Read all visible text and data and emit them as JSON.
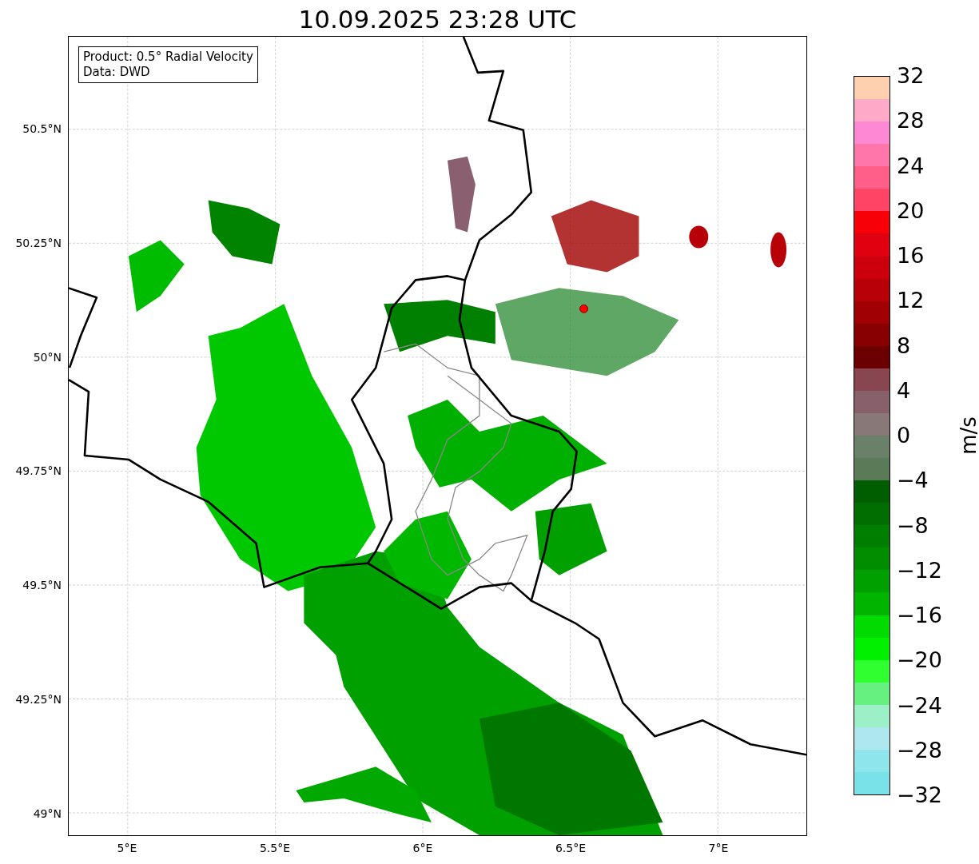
{
  "title": "10.09.2025 23:28 UTC",
  "legend": {
    "lines": [
      "Product: 0.5° Radial Velocity",
      "Data: DWD"
    ]
  },
  "map": {
    "xticks": [
      "5°E",
      "5.5°E",
      "6°E",
      "6.5°E",
      "7°E"
    ],
    "yticks": [
      "50.5°N",
      "50.25°N",
      "50°N",
      "49.75°N",
      "49.5°N",
      "49.25°N",
      "49°N"
    ]
  },
  "colorbar": {
    "label": "m/s",
    "bands": [
      {
        "color": "#ffd0b0"
      },
      {
        "color": "#ffaac8"
      },
      {
        "color": "#ff88d4"
      },
      {
        "color": "#ff77aa"
      },
      {
        "color": "#ff5f88"
      },
      {
        "color": "#ff4466"
      },
      {
        "color": "#f80008"
      },
      {
        "color": "#e00010"
      },
      {
        "color": "#cc000c"
      },
      {
        "color": "#b80008"
      },
      {
        "color": "#a00004"
      },
      {
        "color": "#880000"
      },
      {
        "color": "#6c0000"
      },
      {
        "color": "#884650"
      },
      {
        "color": "#88606c"
      },
      {
        "color": "#887878"
      },
      {
        "color": "#6a8068"
      },
      {
        "color": "#5a7a58"
      },
      {
        "color": "#005e00"
      },
      {
        "color": "#006e00"
      },
      {
        "color": "#007e00"
      },
      {
        "color": "#008e00"
      },
      {
        "color": "#00a000"
      },
      {
        "color": "#00b400"
      },
      {
        "color": "#00dc00"
      },
      {
        "color": "#00f000"
      },
      {
        "color": "#30ff30"
      },
      {
        "color": "#66f080"
      },
      {
        "color": "#9cf0c8"
      },
      {
        "color": "#aee8ee"
      },
      {
        "color": "#8ee6ec"
      },
      {
        "color": "#78e2e8"
      }
    ],
    "ticks": [
      "32",
      "28",
      "24",
      "20",
      "16",
      "12",
      "8",
      "4",
      "0",
      "−4",
      "−8",
      "−12",
      "−16",
      "−20",
      "−24",
      "−28",
      "−32"
    ]
  }
}
